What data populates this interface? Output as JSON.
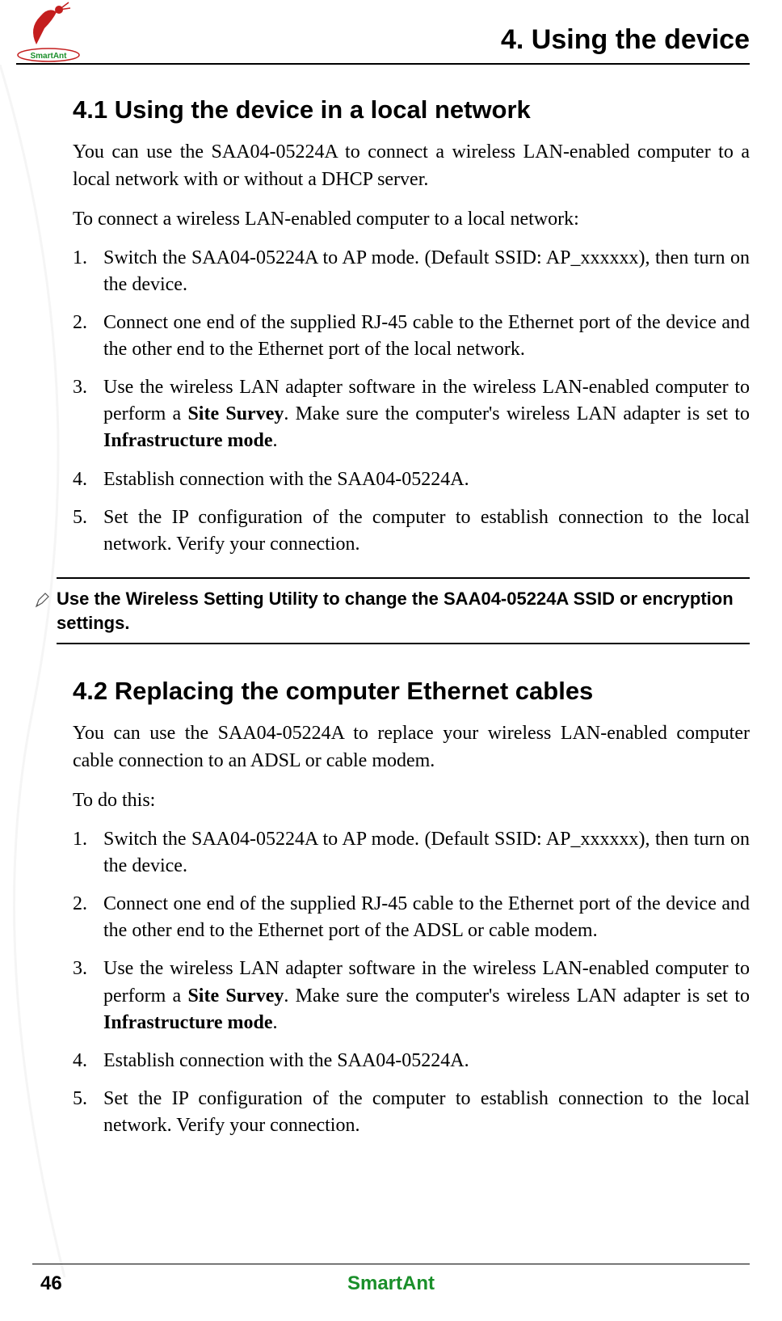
{
  "header": {
    "chapter_title": "4. Using the device",
    "logo_text": "SmartAnt"
  },
  "section41": {
    "heading": "4.1  Using the device in a local network",
    "intro": "You can use the SAA04-05224A to connect a wireless LAN-enabled computer to a local network with or without a DHCP server.",
    "lead": "To connect a wireless LAN-enabled computer to a local network:",
    "steps": {
      "s1": "Switch the SAA04-05224A to AP mode. (Default SSID: AP_xxxxxx), then turn on the device.",
      "s2": "Connect one end of the supplied RJ-45 cable to the Ethernet port of the device and the other end to the Ethernet port of the local network.",
      "s3a": "Use the wireless LAN adapter software in the wireless LAN-enabled computer to perform a ",
      "s3b": "Site Survey",
      "s3c": ". Make sure the computer's wireless LAN adapter is set to ",
      "s3d": "Infrastructure mode",
      "s3e": ".",
      "s4": "Establish connection with the SAA04-05224A.",
      "s5": "Set the IP configuration of the computer to establish connection to the local network. Verify your connection."
    },
    "note": "Use the Wireless Setting Utility to change the SAA04-05224A SSID or encryption settings."
  },
  "section42": {
    "heading": "4.2  Replacing the computer Ethernet cables",
    "intro": "You can use the SAA04-05224A to replace your wireless LAN-enabled computer cable connection to an ADSL or cable modem.",
    "lead": "To do this:",
    "steps": {
      "s1": "Switch the SAA04-05224A to AP mode. (Default SSID: AP_xxxxxx), then turn on the device.",
      "s2": "Connect one end of the supplied RJ-45 cable to the Ethernet port of the device and the other end to the Ethernet port of the ADSL or cable modem.",
      "s3a": "Use the wireless LAN adapter software in the wireless LAN-enabled computer to perform a ",
      "s3b": "Site Survey",
      "s3c": ". Make sure the computer's wireless LAN adapter is set to ",
      "s3d": "Infrastructure mode",
      "s3e": ".",
      "s4": "Establish connection with the SAA04-05224A.",
      "s5": "Set the IP configuration of the computer to establish connection to the local network. Verify your connection."
    }
  },
  "footer": {
    "page": "46",
    "brand": "SmartAnt"
  }
}
